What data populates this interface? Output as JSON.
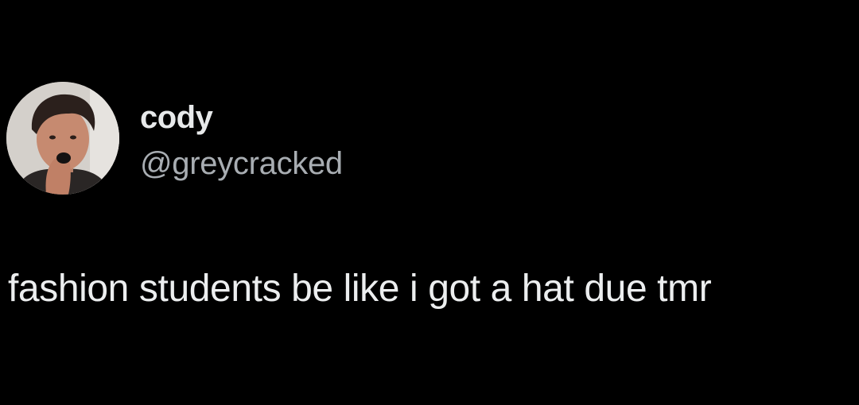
{
  "tweet": {
    "author": {
      "display_name": "cody",
      "handle": "@greycracked",
      "avatar_icon": "profile-photo-avatar"
    },
    "text": "fashion students be like i got a hat due tmr"
  },
  "colors": {
    "background": "#000000",
    "primary_text": "#e7e9ea",
    "secondary_text": "#a8adb2"
  }
}
